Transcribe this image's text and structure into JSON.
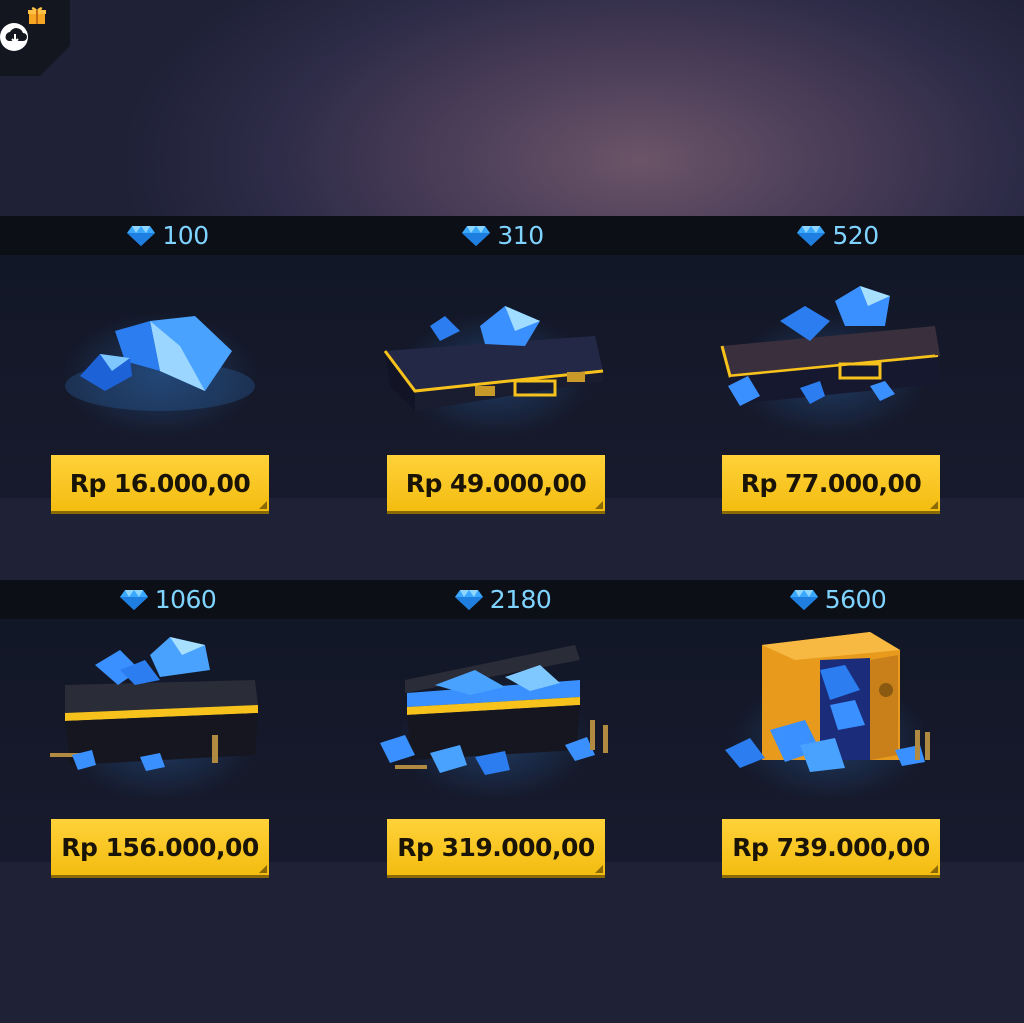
{
  "header": {
    "icons": [
      "cloud-download-icon",
      "gift-icon"
    ]
  },
  "colors": {
    "accent_price": "#f7c21b",
    "diamond_text": "#7fd4ff",
    "panel_dark": "#0d0f17"
  },
  "packages": [
    {
      "diamonds": "100",
      "price": "Rp 16.000,00",
      "art": "gems"
    },
    {
      "diamonds": "310",
      "price": "Rp 49.000,00",
      "art": "briefcase"
    },
    {
      "diamonds": "520",
      "price": "Rp 77.000,00",
      "art": "briefcase-open"
    },
    {
      "diamonds": "1060",
      "price": "Rp 156.000,00",
      "art": "crate"
    },
    {
      "diamonds": "2180",
      "price": "Rp 319.000,00",
      "art": "crate-open"
    },
    {
      "diamonds": "5600",
      "price": "Rp 739.000,00",
      "art": "vault"
    }
  ]
}
